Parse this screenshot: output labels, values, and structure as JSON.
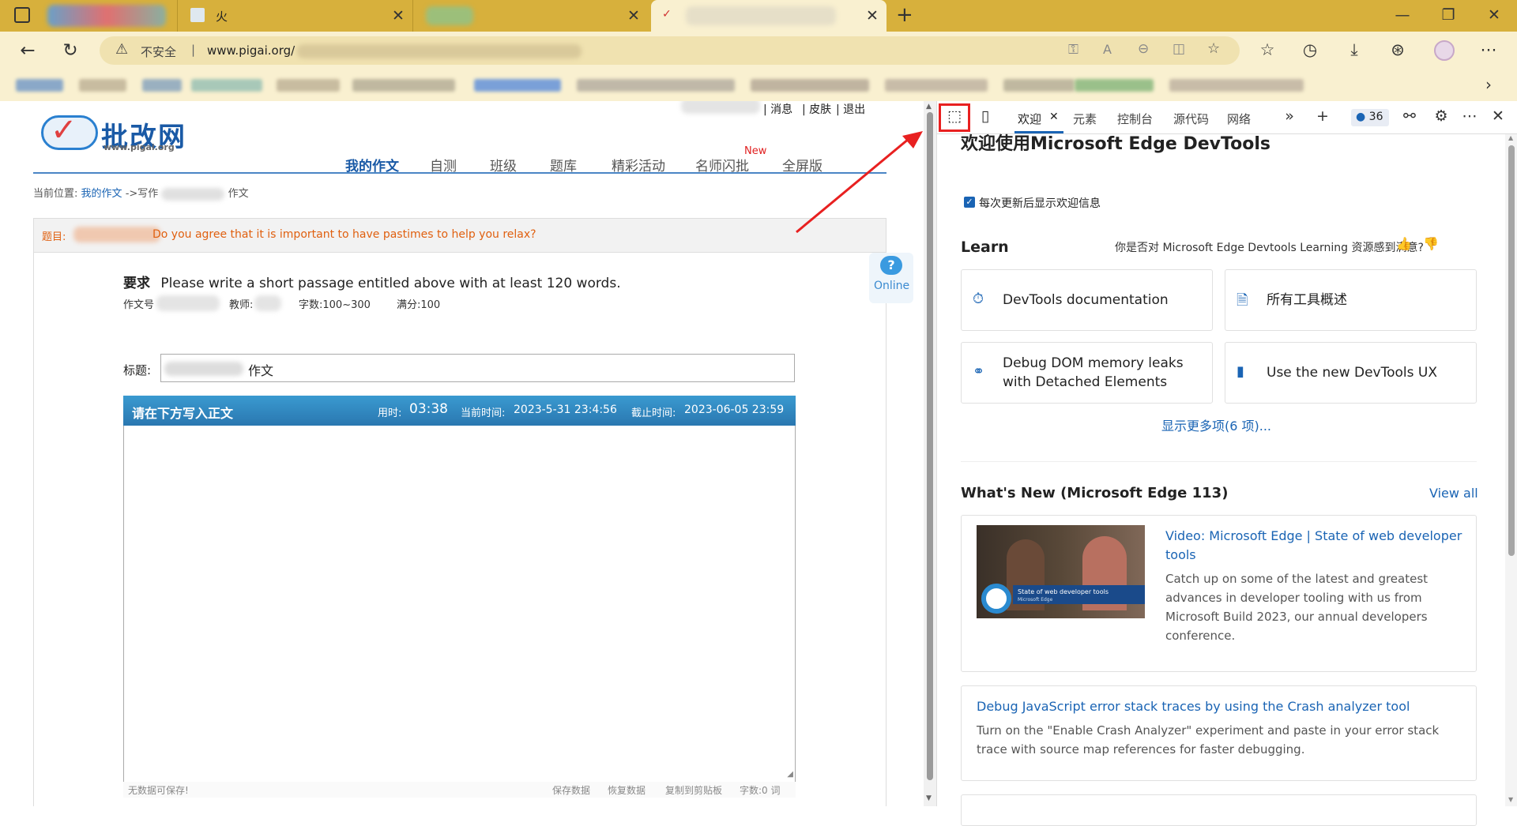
{
  "browser": {
    "tabs": [
      {
        "label": "",
        "active": false
      },
      {
        "label": "火",
        "active": false
      },
      {
        "label": "",
        "active": false
      },
      {
        "label": "",
        "active": true
      }
    ],
    "new_tab": "+",
    "address": {
      "security_text": "不安全",
      "url": "www.pigai.org/"
    },
    "window_controls": [
      "—",
      "❐",
      "✕"
    ]
  },
  "page": {
    "logo_title": "批改网",
    "logo_sub": "www.pigai.org",
    "top_menu": [
      "| 消息",
      "| 皮肤",
      "| 退出"
    ],
    "nav": [
      "我的作文",
      "自测",
      "班级",
      "题库",
      "精彩活动",
      "名师闪批",
      "全屏版"
    ],
    "nav_new_badge": "New",
    "breadcrumb_prefix": "当前位置:",
    "breadcrumb_link": "我的作文",
    "breadcrumb_rest": "->写作",
    "breadcrumb_end": "作文",
    "question_label": "题目:",
    "question_text": "Do you agree that it is important to have pastimes to help you relax?",
    "requirement_label": "要求",
    "requirement_text": "Please write a short passage entitled above with at least 120 words.",
    "essay_no_label": "作文号",
    "teacher_label": "教师:",
    "word_count_range": "字数:100~300",
    "full_score": "满分:100",
    "title_label": "标题:",
    "title_value": "作文",
    "write_header": "请在下方写入正文",
    "time_used_label": "用时:",
    "time_used": "03:38",
    "current_time_label": "当前时间:",
    "current_time": "2023-5-31 23:4:56",
    "deadline_label": "截止时间:",
    "deadline": "2023-06-05 23:59",
    "status_left": "无数据可保存!",
    "status_actions": [
      "保存数据",
      "恢复数据",
      "复制到剪贴板",
      "字数:0 词"
    ],
    "online_label": "Online"
  },
  "devtools": {
    "tabs": [
      "欢迎",
      "元素",
      "控制台",
      "源代码",
      "网络"
    ],
    "issues_count": "36",
    "welcome_title": "欢迎使用Microsoft Edge DevTools",
    "show_welcome_checkbox": "每次更新后显示欢迎信息",
    "learn_heading": "Learn",
    "feedback_question": "你是否对 Microsoft Edge Devtools Learning 资源感到满意?",
    "learn_cards": [
      {
        "icon": "gauge-icon",
        "label": "DevTools documentation"
      },
      {
        "icon": "document-icon",
        "label": "所有工具概述"
      },
      {
        "icon": "memory-icon",
        "label": "Debug DOM memory leaks with Detached Elements"
      },
      {
        "icon": "panel-icon",
        "label": "Use the new DevTools UX"
      }
    ],
    "show_more": "显示更多项(6 项)...",
    "whats_new_heading": "What's New (Microsoft Edge 113)",
    "view_all": "View all",
    "news": [
      {
        "title": "Video: Microsoft Edge | State of web developer tools",
        "body": "Catch up on some of the latest and greatest advances in developer tooling with us from Microsoft Build 2023, our annual developers conference.",
        "thumb_caption": "State of web developer tools",
        "thumb_sub": "Microsoft Edge"
      },
      {
        "title": "Debug JavaScript error stack traces by using the Crash analyzer tool",
        "body": "Turn on the \"Enable Crash Analyzer\" experiment and paste in your error stack trace with source map references for faster debugging."
      }
    ]
  }
}
